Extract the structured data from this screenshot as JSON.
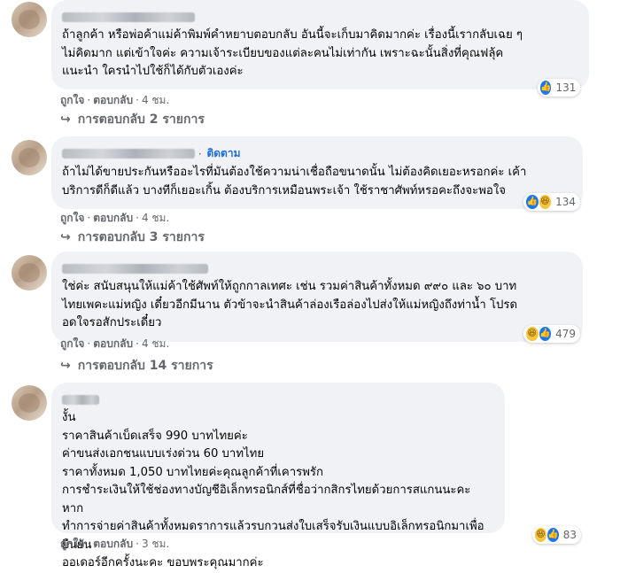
{
  "comments": [
    {
      "follow": "",
      "text": "ถ้าลูกค้า หรือพ่อค้าแม่ค้าพิมพ์คำหยาบตอบกลับ อันนี้จะเก็บมาคิดมากค่ะ เรื่องนี้เรากลับเฉย ๆ\nไม่คิดมาก แต่เข้าใจค่ะ ความเจ้าระเบียบของแต่ละคนไม่เท่ากัน เพราะฉะนั้นสิ่งที่คุณฟลุ้ค\nแนะนำ ใครนำไปใช้ก็ได้กับตัวเองค่ะ",
      "like": "ถูกใจ",
      "reply": "ตอบกลับ",
      "time": "4 ชม.",
      "reaction_count": "131",
      "reaction_icons": [
        "like-icon"
      ],
      "replies_label": "การตอบกลับ 2 รายการ"
    },
    {
      "follow": "ติดตาม",
      "text": "ถ้าไม่ได้ขายประกันหรืออะไรที่มันต้องใช้ความน่าเชื่อถือขนาดนั้น ไม่ต้องคิดเยอะหรอกค่ะ เค้า\nบริการดีก็ดีแล้ว บางทีก็เยอะเกิ้น ต้องบริการเหมือนพระเจ้า ใช้ราชาศัพท์หรอคะถึงจะพอใจ",
      "like": "ถูกใจ",
      "reply": "ตอบกลับ",
      "time": "4 ชม.",
      "reaction_count": "134",
      "reaction_icons": [
        "like-icon",
        "haha-icon"
      ],
      "replies_label": "การตอบกลับ 3 รายการ"
    },
    {
      "follow": "",
      "text": "ใช่ค่ะ สนับสนุนให้แม่ค้าใช้ศัพท์ให้ถูกกาลเทศะ เช่น รวมค่าสินค้าทั้งหมด ๙๙๐ และ ๖๐ บาท\nไทยเพคะแม่หญิง เดี๋ยวอีกมีนาน ตัวข้าจะนำสินค้าล่องเรือล่องไปส่งให้แม่หญิงถึงท่าน้ำ โปรด\nอดใจรอสักประเดี๋ยว",
      "like": "ถูกใจ",
      "reply": "ตอบกลับ",
      "time": "4 ชม.",
      "reaction_count": "479",
      "reaction_icons": [
        "haha-icon",
        "like-icon"
      ],
      "replies_label": "การตอบกลับ 14 รายการ"
    },
    {
      "follow": "",
      "text": "งั้น\nราคาสินค้าเบ็ดเสร็จ 990 บาทไทยค่ะ\nค่าขนส่งเอกชนแบบเร่งด่วน 60 บาทไทย\nราคาทั้งหมด 1,050 บาทไทยค่ะคุณลูกค้าที่เคารพรัก\nการชำระเงินให้ใช้ช่องทางบัญชีอิเล็กทรอนิกส์ที่ชื่อว่ากสิกรไทยด้วยการสแกนนะคะ หาก\nทำการจ่ายค่าสินค้าทั้งหมดราการแล้วรบกวนส่งใบเสร็จรับเงินแบบอิเล็กทรอนิกมาเพื่อยืนยัน\nออเดอร์อีกครั้งนะคะ ขอบพระคุณมากค่ะ",
      "like": "ถูกใจ",
      "reply": "ตอบกลับ",
      "time": "3 ชม.",
      "reaction_count": "83",
      "reaction_icons": [
        "haha-icon",
        "like-icon"
      ],
      "replies_label": ""
    }
  ],
  "colors": {
    "bubble": "#f0f2f5",
    "meta_text": "#65676b",
    "follow_link": "#216fdb",
    "like_blue": "#1877f2",
    "haha_yellow": "#f7c53b"
  }
}
